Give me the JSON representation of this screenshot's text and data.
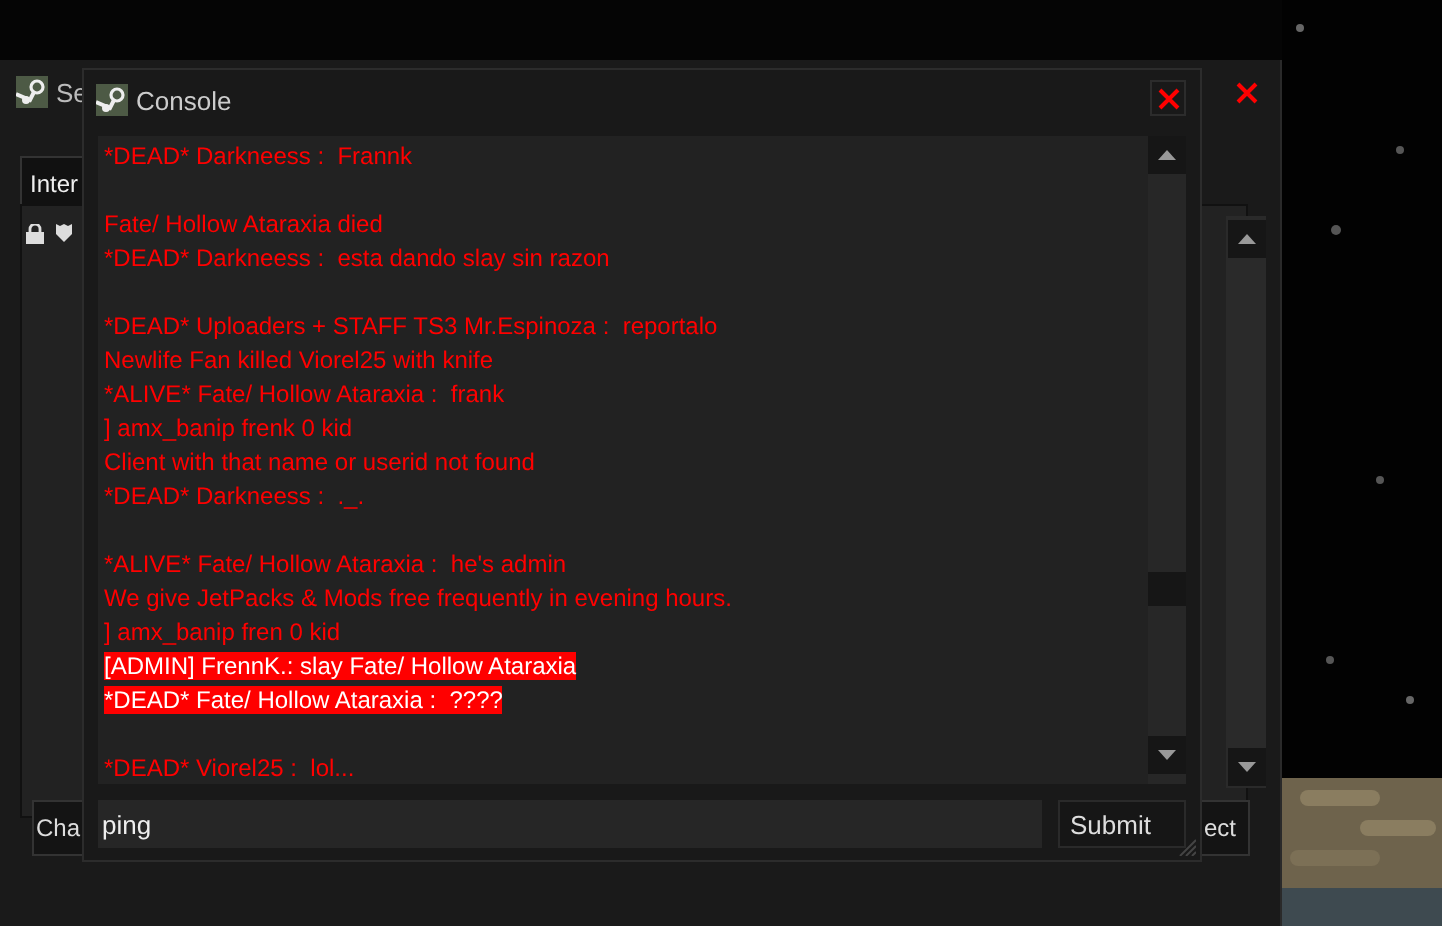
{
  "server_window": {
    "title": "Se",
    "tab": "Inter",
    "buttons": [
      "Cha",
      "ect"
    ]
  },
  "console": {
    "title": "Console",
    "lines": [
      {
        "text": "*DEAD* Darkneess :  Frannk",
        "highlighted": false,
        "spaced": false
      },
      {
        "text": "Fate/ Hollow Ataraxia died",
        "highlighted": false,
        "spaced": true
      },
      {
        "text": "*DEAD* Darkneess :  esta dando slay sin razon",
        "highlighted": false,
        "spaced": false
      },
      {
        "text": "*DEAD* Uploaders + STAFF TS3 Mr.Espinoza :  reportalo",
        "highlighted": false,
        "spaced": true
      },
      {
        "text": "Newlife Fan killed Viorel25 with knife",
        "highlighted": false,
        "spaced": false
      },
      {
        "text": "*ALIVE* Fate/ Hollow Ataraxia :  frank",
        "highlighted": false,
        "spaced": false
      },
      {
        "text": "] amx_banip frenk 0 kid",
        "highlighted": false,
        "spaced": false
      },
      {
        "text": "Client with that name or userid not found",
        "highlighted": false,
        "spaced": false
      },
      {
        "text": "*DEAD* Darkneess :  ._.",
        "highlighted": false,
        "spaced": false
      },
      {
        "text": "*ALIVE* Fate/ Hollow Ataraxia :  he's admin",
        "highlighted": false,
        "spaced": true
      },
      {
        "text": "We give JetPacks & Mods free frequently in evening hours.",
        "highlighted": false,
        "spaced": false
      },
      {
        "text": "] amx_banip fren 0 kid",
        "highlighted": false,
        "spaced": false
      },
      {
        "text": "[ADMIN] FrennK.: slay Fate/ Hollow Ataraxia",
        "highlighted": true,
        "spaced": false
      },
      {
        "text": "*DEAD* Fate/ Hollow Ataraxia :  ????",
        "highlighted": true,
        "spaced": false
      },
      {
        "text": "*DEAD* Viorel25 :  lol...",
        "highlighted": false,
        "spaced": true
      }
    ],
    "input": {
      "value": "ping"
    },
    "submit": "Submit"
  }
}
